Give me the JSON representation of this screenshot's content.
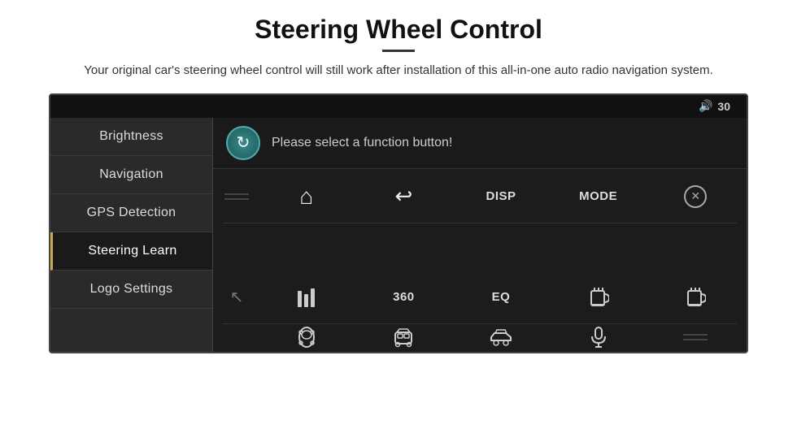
{
  "page": {
    "title": "Steering Wheel Control",
    "subtitle": "Your original car's steering wheel control will still work after installation of this all-in-one auto radio navigation system.",
    "divider_visible": true
  },
  "topbar": {
    "volume_icon": "🔊",
    "volume_value": "30"
  },
  "sidebar": {
    "items": [
      {
        "id": "brightness",
        "label": "Brightness",
        "active": false
      },
      {
        "id": "navigation",
        "label": "Navigation",
        "active": false
      },
      {
        "id": "gps-detection",
        "label": "GPS Detection",
        "active": false
      },
      {
        "id": "steering-learn",
        "label": "Steering Learn",
        "active": true
      },
      {
        "id": "logo-settings",
        "label": "Logo Settings",
        "active": false
      }
    ]
  },
  "function_header": {
    "prompt": "Please select a function button!",
    "refresh_label": "↻"
  },
  "grid": {
    "row1": [
      "",
      "⌂",
      "↩",
      "DISP",
      "MODE",
      "⊘"
    ],
    "row2": [
      "↖",
      "⠿",
      "360",
      "EQ",
      "🍺",
      "🍺"
    ],
    "row3": [
      "",
      "🚗",
      "🚗",
      "🚗",
      "🎤",
      ""
    ]
  },
  "icons": {
    "house": "⌂",
    "back": "↩",
    "no_call": "⊘",
    "eq_bars": "⠿",
    "three_sixty": "360",
    "eq_text": "EQ",
    "disp": "DISP",
    "mode": "MODE",
    "cursor": "↖"
  }
}
